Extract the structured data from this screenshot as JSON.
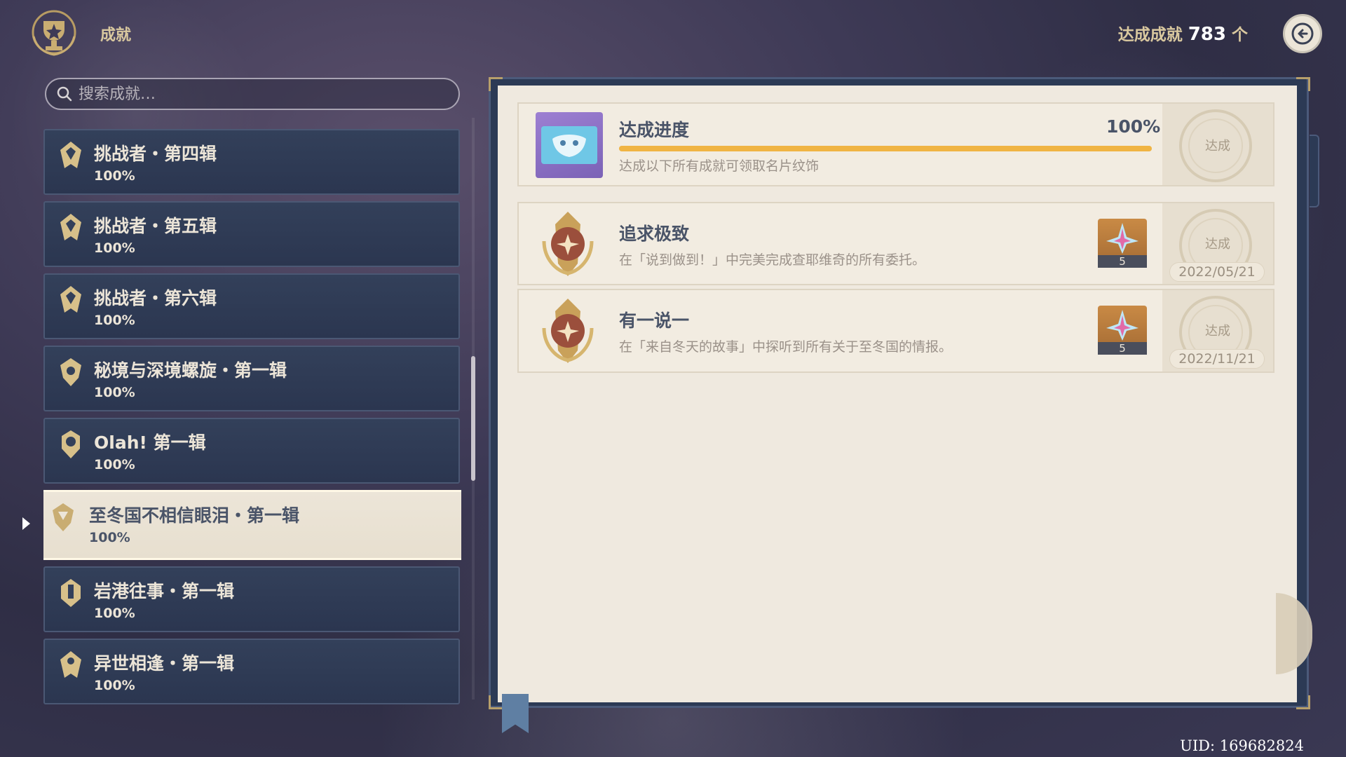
{
  "header": {
    "title": "成就",
    "total_label": "达成成就",
    "total_count": "783",
    "total_unit": "个"
  },
  "search": {
    "placeholder": "搜索成就…"
  },
  "categories": [
    {
      "name": "挑战者・第四辑",
      "percent": "100%",
      "selected": false
    },
    {
      "name": "挑战者・第五辑",
      "percent": "100%",
      "selected": false
    },
    {
      "name": "挑战者・第六辑",
      "percent": "100%",
      "selected": false
    },
    {
      "name": "秘境与深境螺旋・第一辑",
      "percent": "100%",
      "selected": false
    },
    {
      "name": "Olah! 第一辑",
      "percent": "100%",
      "selected": false
    },
    {
      "name": "至冬国不相信眼泪・第一辑",
      "percent": "100%",
      "selected": true
    },
    {
      "name": "岩港往事・第一辑",
      "percent": "100%",
      "selected": false
    },
    {
      "name": "异世相逢・第一辑",
      "percent": "100%",
      "selected": false
    }
  ],
  "summary": {
    "title": "达成进度",
    "percent": "100%",
    "progress": 1.0,
    "description": "达成以下所有成就可领取名片纹饰",
    "stamp": "达成"
  },
  "achievements": [
    {
      "title": "追求极致",
      "description": "在「说到做到！」中完美完成查耶维奇的所有委托。",
      "reward_count": "5",
      "stamp": "达成",
      "date": "2022/05/21"
    },
    {
      "title": "有一说一",
      "description": "在「来自冬天的故事」中探听到所有关于至冬国的情报。",
      "reward_count": "5",
      "stamp": "达成",
      "date": "2022/11/21"
    }
  ],
  "footer": {
    "uid": "UID: 169682824"
  },
  "colors": {
    "gold": "#d9c89f",
    "progress": "#f0b443",
    "card_bg": "#f2ece1",
    "list_bg": "#2f3a54"
  }
}
